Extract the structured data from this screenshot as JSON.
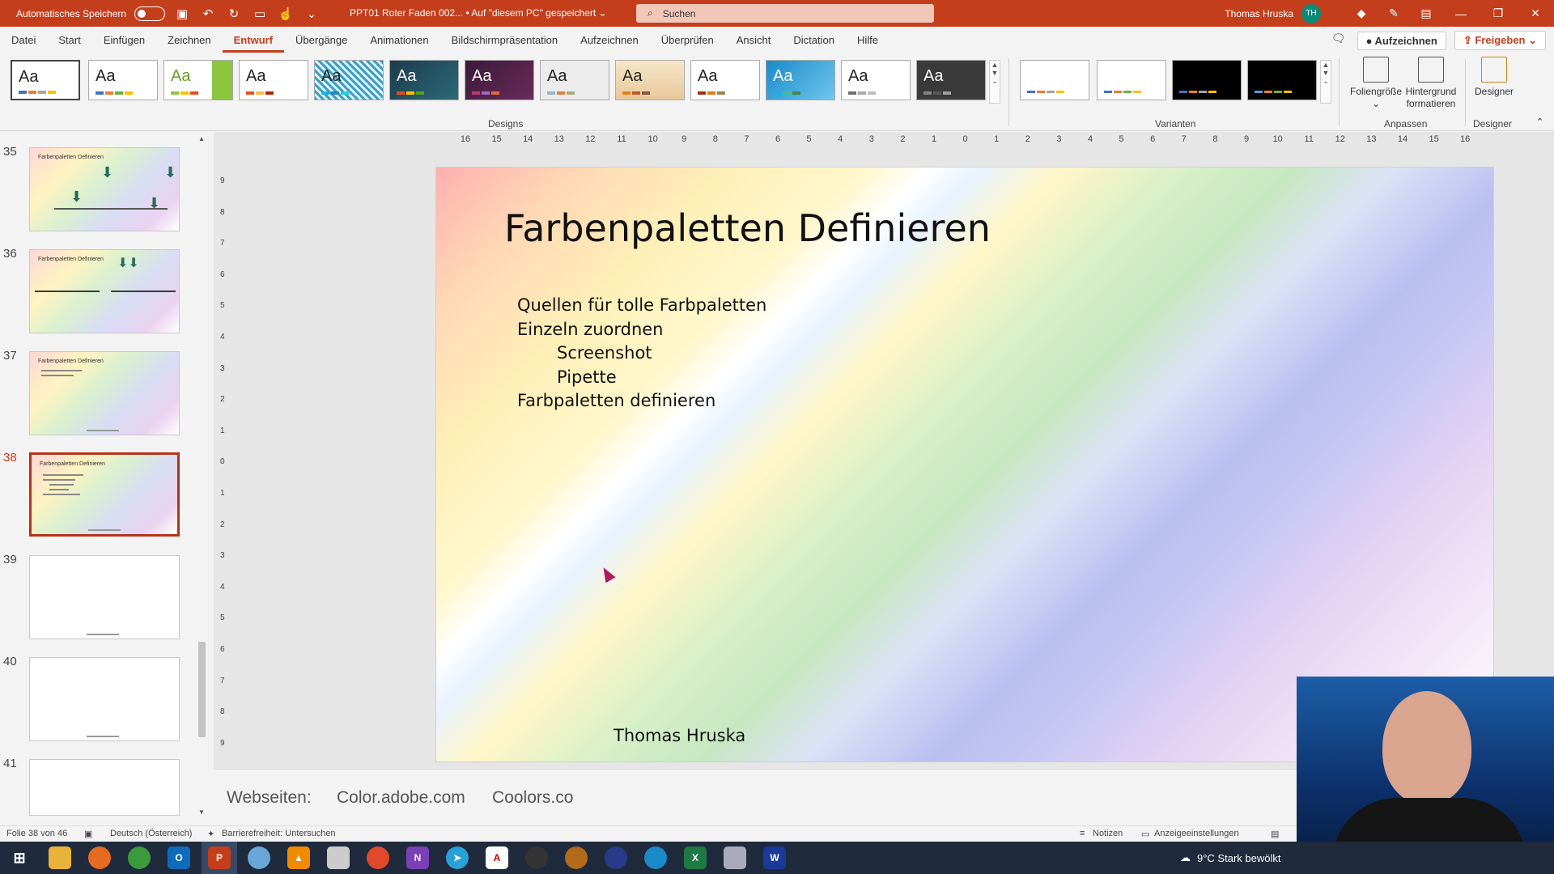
{
  "titlebar": {
    "autosave_label": "Automatisches Speichern",
    "doc_title": "PPT01 Roter Faden 002... • Auf \"diesem PC\" gespeichert ⌄",
    "search_placeholder": "Suchen",
    "user_name": "Thomas Hruska",
    "user_initials": "TH"
  },
  "menu": {
    "items": [
      "Datei",
      "Start",
      "Einfügen",
      "Zeichnen",
      "Entwurf",
      "Übergänge",
      "Animationen",
      "Bildschirmpräsentation",
      "Aufzeichnen",
      "Überprüfen",
      "Ansicht",
      "Dictation",
      "Hilfe"
    ],
    "active": "Entwurf",
    "record_label": "Aufzeichnen",
    "share_label": "Freigeben"
  },
  "ribbon": {
    "designs_label": "Designs",
    "variants_label": "Varianten",
    "customize_label": "Anpassen",
    "designer_group_label": "Designer",
    "slide_size_label": "Foliengröße",
    "format_bg_label_1": "Hintergrund",
    "format_bg_label_2": "formatieren",
    "designer_label": "Designer",
    "theme_sample": "Aa"
  },
  "thumbnails": {
    "slides": [
      {
        "num": "35",
        "title": "Farbenpaletten Definieren"
      },
      {
        "num": "36",
        "title": "Farbenpaletten Definieren"
      },
      {
        "num": "37",
        "title": "Farbenpaletten Definieren"
      },
      {
        "num": "38",
        "title": "Farbenpaletten Definieren"
      },
      {
        "num": "39",
        "title": ""
      },
      {
        "num": "40",
        "title": ""
      },
      {
        "num": "41",
        "title": ""
      }
    ],
    "selected": "38"
  },
  "ruler": {
    "h_ticks": [
      "16",
      "15",
      "14",
      "13",
      "12",
      "11",
      "10",
      "9",
      "8",
      "7",
      "6",
      "5",
      "4",
      "3",
      "2",
      "1",
      "0",
      "1",
      "2",
      "3",
      "4",
      "5",
      "6",
      "7",
      "8",
      "9",
      "10",
      "11",
      "12",
      "13",
      "14",
      "15",
      "16"
    ],
    "v_ticks": [
      "9",
      "8",
      "7",
      "6",
      "5",
      "4",
      "3",
      "2",
      "1",
      "0",
      "1",
      "2",
      "3",
      "4",
      "5",
      "6",
      "7",
      "8",
      "9"
    ]
  },
  "slide": {
    "title": "Farbenpaletten Definieren",
    "bullet_1": "Quellen für tolle Farbpaletten",
    "bullet_2": "Einzeln zuordnen",
    "bullet_2a": "Screenshot",
    "bullet_2b": "Pipette",
    "bullet_3": "Farbpaletten definieren",
    "author": "Thomas Hruska"
  },
  "notes": {
    "label": "Webseiten:",
    "site_1": "Color.adobe.com",
    "site_2": "Coolors.co"
  },
  "status": {
    "slide_count": "Folie 38 von 46",
    "language": "Deutsch (Österreich)",
    "accessibility": "Barrierefreiheit: Untersuchen",
    "notes_btn": "Notizen",
    "display_settings": "Anzeigeeinstellungen"
  },
  "taskbar": {
    "weather": "9°C  Stark bewölkt"
  },
  "colors": {
    "accent": "#c43e1c",
    "taskbar": "#1f2a3d"
  }
}
